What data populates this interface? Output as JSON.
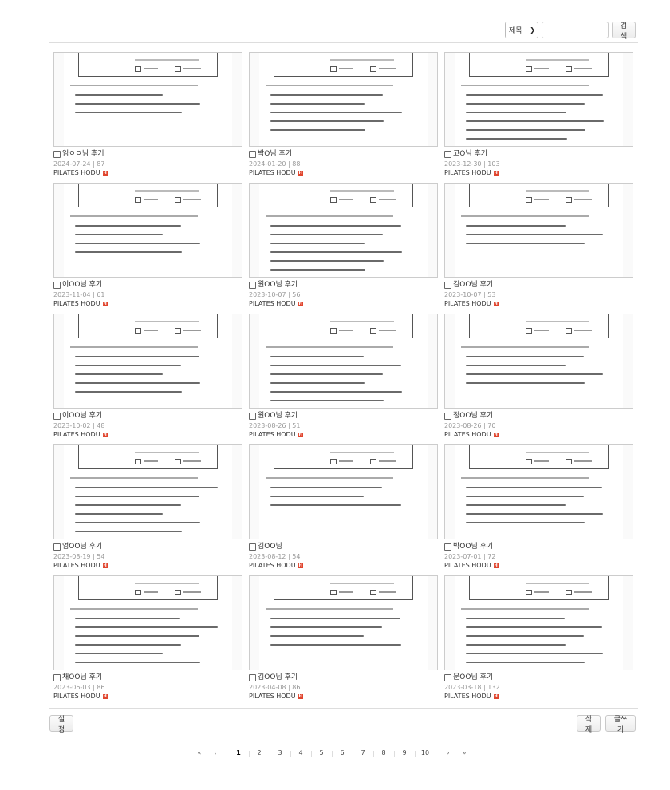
{
  "search": {
    "field_option": "제목",
    "query": "",
    "button_label": "검색"
  },
  "posts": [
    {
      "title": "임ㅇㅇ님 후기",
      "meta": "2024-07-24 | 87",
      "author": "PILATES HODU"
    },
    {
      "title": "박O님 후기",
      "meta": "2024-01-20 | 88",
      "author": "PILATES HODU"
    },
    {
      "title": "고O님 후기",
      "meta": "2023-12-30 | 103",
      "author": "PILATES HODU"
    },
    {
      "title": "이OO님 후기",
      "meta": "2023-11-04 | 61",
      "author": "PILATES HODU"
    },
    {
      "title": "원OO님 후기",
      "meta": "2023-10-07 | 56",
      "author": "PILATES HODU"
    },
    {
      "title": "김OO님 후기",
      "meta": "2023-10-07 | 53",
      "author": "PILATES HODU"
    },
    {
      "title": "이OO님 후기",
      "meta": "2023-10-02 | 48",
      "author": "PILATES HODU"
    },
    {
      "title": "원OO님 후기",
      "meta": "2023-08-26 | 51",
      "author": "PILATES HODU"
    },
    {
      "title": "정OO님 후기",
      "meta": "2023-08-26 | 70",
      "author": "PILATES HODU"
    },
    {
      "title": "엄OO님 후기",
      "meta": "2023-08-19 | 54",
      "author": "PILATES HODU"
    },
    {
      "title": "김OO님",
      "meta": "2023-08-12 | 54",
      "author": "PILATES HODU"
    },
    {
      "title": "박OO님 후기",
      "meta": "2023-07-01 | 72",
      "author": "PILATES HODU"
    },
    {
      "title": "채OO님 후기",
      "meta": "2023-06-03 | 86",
      "author": "PILATES HODU"
    },
    {
      "title": "김OO님 후기",
      "meta": "2023-04-08 | 86",
      "author": "PILATES HODU"
    },
    {
      "title": "문OO님 후기",
      "meta": "2023-03-18 | 132",
      "author": "PILATES HODU"
    }
  ],
  "new_badge": "H",
  "actions": {
    "settings_label": "설정",
    "delete_label": "삭제",
    "write_label": "글쓰기"
  },
  "pagination": {
    "first": "«",
    "prev": "‹",
    "pages": [
      "1",
      "2",
      "3",
      "4",
      "5",
      "6",
      "7",
      "8",
      "9",
      "10"
    ],
    "current": "1",
    "next": "›",
    "last": "»"
  },
  "colors": {
    "accent": "#e0452e",
    "border": "#cccccc",
    "meta_text": "#999999"
  },
  "icons": {
    "select_arrow": "chevron-down-icon",
    "new_badge": "new-badge-icon"
  }
}
